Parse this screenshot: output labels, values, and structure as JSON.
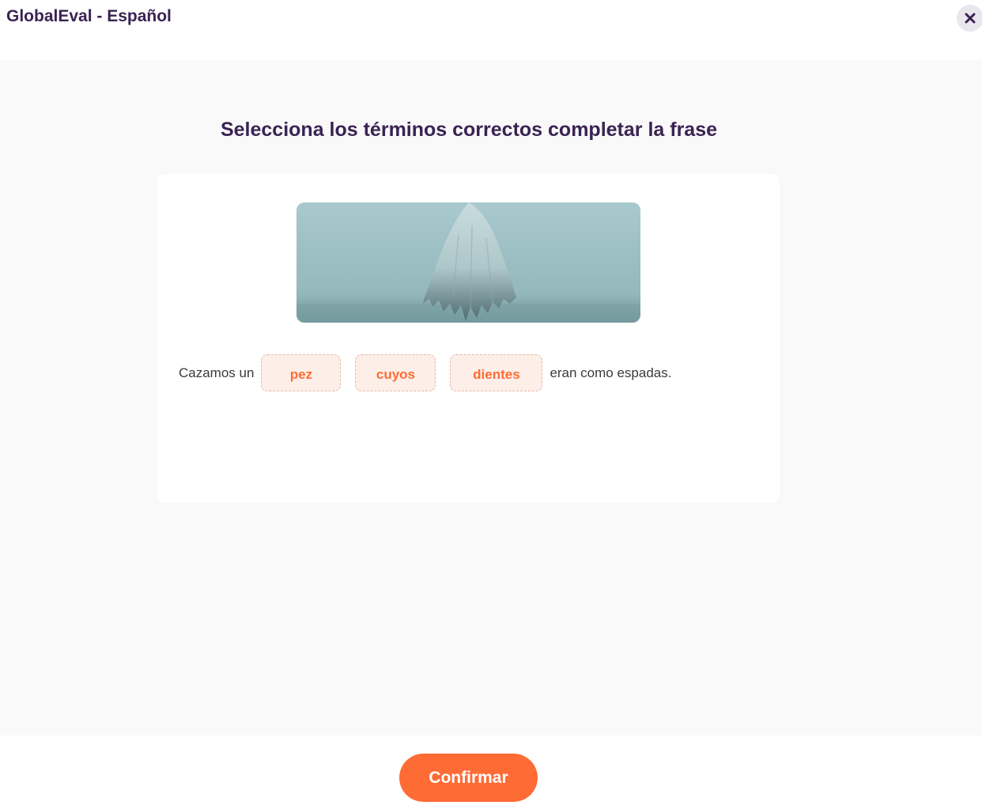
{
  "header": {
    "title": "GlobalEval - Español",
    "close_icon": "close-icon"
  },
  "question": {
    "title": "Selecciona los términos correctos completar la frase",
    "image_icon": "ghost-illustration",
    "sentence": {
      "before": "Cazamos un",
      "blanks": [
        "pez",
        "cuyos",
        "dientes"
      ],
      "after": "eran como espadas."
    }
  },
  "footer": {
    "confirm_label": "Confirmar"
  },
  "colors": {
    "accent": "#ff6b35",
    "title": "#3a2353",
    "slot_bg": "#fdeee7",
    "background": "#f9f9f9"
  }
}
